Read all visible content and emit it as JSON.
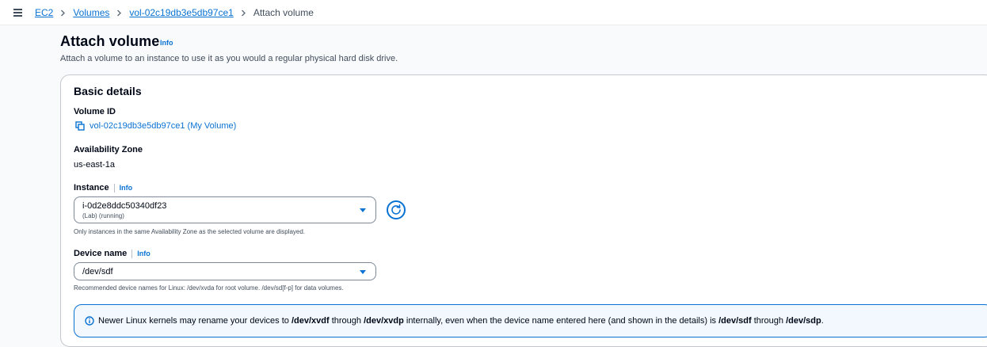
{
  "breadcrumb": {
    "items": [
      "EC2",
      "Volumes",
      "vol-02c19db3e5db97ce1"
    ],
    "current": "Attach volume"
  },
  "page": {
    "title": "Attach volume",
    "title_info": "Info",
    "description": "Attach a volume to an instance to use it as you would a regular physical hard disk drive."
  },
  "panel": {
    "title": "Basic details",
    "volume_id_label": "Volume ID",
    "volume_id_value": "vol-02c19db3e5db97ce1 (My Volume)",
    "az_label": "Availability Zone",
    "az_value": "us-east-1a",
    "instance_label": "Instance",
    "instance_info": "Info",
    "instance_selected": "i-0d2e8ddc50340df23",
    "instance_selected_sub": "(Lab) (running)",
    "instance_hint": "Only instances in the same Availability Zone as the selected volume are displayed.",
    "device_label": "Device name",
    "device_info": "Info",
    "device_selected": "/dev/sdf",
    "device_hint": "Recommended device names for Linux: /dev/xvda for root volume. /dev/sd[f-p] for data volumes."
  },
  "alert": {
    "t1": "Newer Linux kernels may rename your devices to ",
    "b1": "/dev/xvdf",
    "t2": " through ",
    "b2": "/dev/xvdp",
    "t3": " internally, even when the device name entered here (and shown in the details) is ",
    "b3": "/dev/sdf",
    "t4": " through ",
    "b4": "/dev/sdp",
    "t5": "."
  },
  "colors": {
    "link": "#0972d3",
    "alert_bg": "#f2f8fd"
  },
  "icons": [
    "menu-icon",
    "chevron-right-icon",
    "copy-icon",
    "refresh-icon",
    "caret-down-icon",
    "info-circle-icon"
  ]
}
